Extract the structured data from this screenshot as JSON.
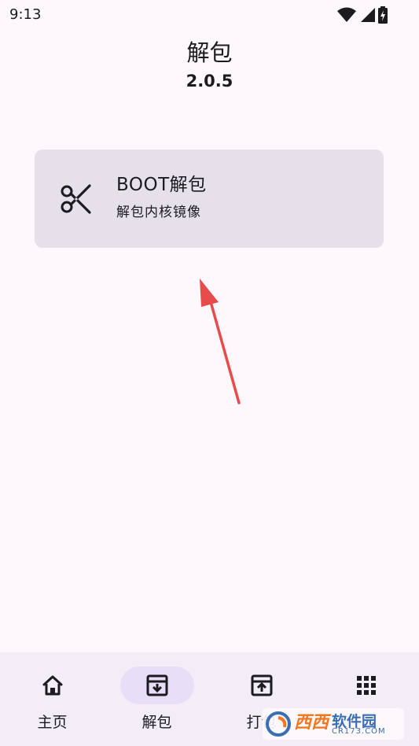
{
  "status_bar": {
    "time": "9:13",
    "icons": [
      "wifi-icon",
      "signal-icon",
      "battery-charging-icon"
    ]
  },
  "header": {
    "title": "解包",
    "version": "2.0.5"
  },
  "card": {
    "icon": "scissors-icon",
    "title": "BOOT解包",
    "subtitle": "解包内核镜像"
  },
  "annotation": {
    "color": "#e84b4b"
  },
  "bottom_nav": {
    "active_index": 1,
    "items": [
      {
        "icon": "home-icon",
        "label": "主页"
      },
      {
        "icon": "archive-download-icon",
        "label": "解包"
      },
      {
        "icon": "archive-upload-icon",
        "label": "打包"
      },
      {
        "icon": "apps-grid-icon",
        "label": ""
      }
    ]
  },
  "watermark": {
    "brand": "西西",
    "main": "软件园",
    "sub": "CR173.COM"
  },
  "colors": {
    "background": "#fdf8fc",
    "card": "#e6e0ea",
    "nav_background": "#f3edf7",
    "nav_active_pill": "#e8def8",
    "text": "#1c1b1f"
  }
}
